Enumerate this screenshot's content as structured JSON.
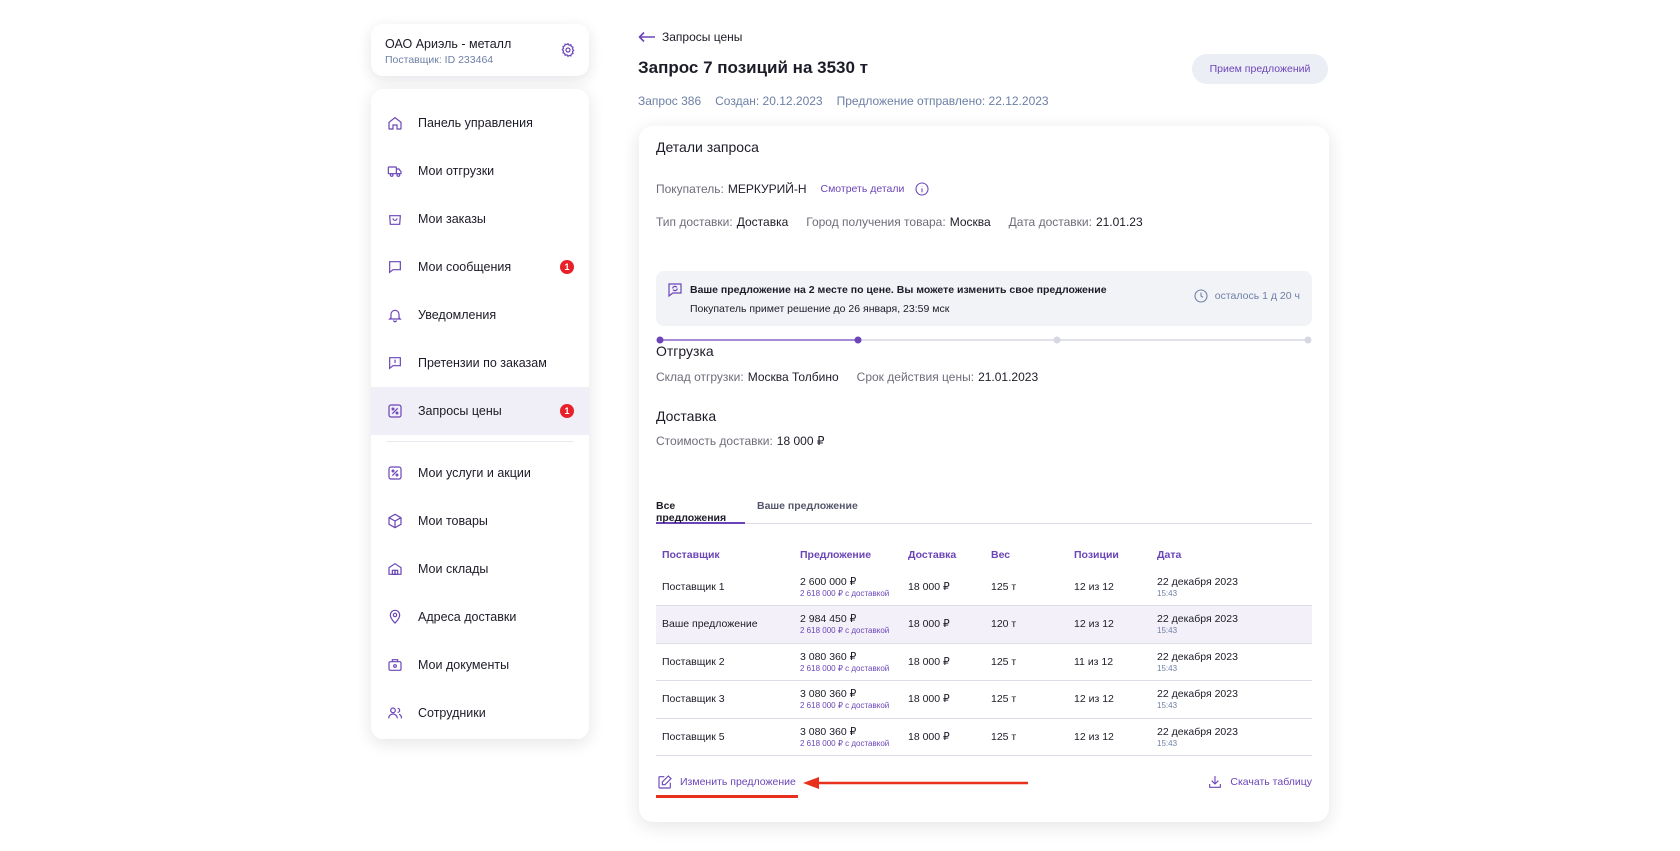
{
  "org": {
    "name": "ОАО Ариэль - металл",
    "supplier_id": "Поставщик: ID 233464"
  },
  "sidebar": {
    "items": [
      {
        "label": "Панель управления"
      },
      {
        "label": "Мои отгрузки"
      },
      {
        "label": "Мои заказы"
      },
      {
        "label": "Мои сообщения",
        "badge": "1"
      },
      {
        "label": "Уведомления"
      },
      {
        "label": "Претензии по заказам"
      },
      {
        "label": "Запросы цены",
        "badge": "1",
        "active": true
      },
      {
        "label": "Мои услуги и акции"
      },
      {
        "label": "Мои товары"
      },
      {
        "label": "Мои склады"
      },
      {
        "label": "Адреса доставки"
      },
      {
        "label": "Мои документы"
      },
      {
        "label": "Сотрудники"
      }
    ]
  },
  "header": {
    "back_label": "Запросы цены",
    "title": "Запрос 7 позиций на 3530 т",
    "status": "Прием предложений",
    "request_no": "Запрос 386",
    "created": "Создан: 20.12.2023",
    "offer_sent": "Предложение отправлено: 22.12.2023"
  },
  "details": {
    "section_title": "Детали запроса",
    "buyer_label": "Покупатель:",
    "buyer_value": "МЕРКУРИЙ-Н",
    "details_link": "Смотреть детали",
    "delivery_type_label": "Тип доставки:",
    "delivery_type_value": "Доставка",
    "city_label": "Город получения товара:",
    "city_value": "Москва",
    "delivery_date_label": "Дата доставки:",
    "delivery_date_value": "21.01.23"
  },
  "notice": {
    "title": "Ваше предложение на 2 месте по цене. Вы можете изменить свое предложение",
    "subtitle": "Покупатель примет решение до 26 января, 23:59 мск",
    "timer": "осталось 1 д 20 ч"
  },
  "progress": {
    "steps": 4,
    "completed": 2
  },
  "shipment": {
    "title": "Отгрузка",
    "warehouse_label": "Склад отгрузки:",
    "warehouse_value": "Москва Толбино",
    "price_valid_label": "Срок действия цены:",
    "price_valid_value": "21.01.2023"
  },
  "delivery": {
    "title": "Доставка",
    "cost_label": "Стоимость доставки:",
    "cost_value": "18 000 ₽"
  },
  "tabs": [
    {
      "label": "Все предложения",
      "active": true
    },
    {
      "label": "Ваше предложение",
      "active": false
    }
  ],
  "table": {
    "columns": [
      "Поставщик",
      "Предложение",
      "Доставка",
      "Вес",
      "Позиции",
      "Дата"
    ],
    "rows": [
      {
        "supplier": "Поставщик 1",
        "offer": "2 600 000 ₽",
        "offer_sub": "2 618 000 ₽ с доставкой",
        "delivery": "18 000 ₽",
        "weight": "125 т",
        "positions": "12 из 12",
        "date": "22 декабря 2023",
        "time": "15:43"
      },
      {
        "supplier": "Ваше предложение",
        "offer": "2 984 450 ₽",
        "offer_sub": "2 618 000 ₽ с доставкой",
        "delivery": "18 000 ₽",
        "weight": "120 т",
        "positions": "12 из 12",
        "date": "22 декабря 2023",
        "time": "15:43",
        "own": true
      },
      {
        "supplier": "Поставщик 2",
        "offer": "3 080 360 ₽",
        "offer_sub": "2 618 000 ₽ с доставкой",
        "delivery": "18 000 ₽",
        "weight": "125 т",
        "positions": "11 из 12",
        "date": "22 декабря 2023",
        "time": "15:43"
      },
      {
        "supplier": "Поставщик 3",
        "offer": "3 080 360 ₽",
        "offer_sub": "2 618 000 ₽ с доставкой",
        "delivery": "18 000 ₽",
        "weight": "125 т",
        "positions": "12 из 12",
        "date": "22 декабря 2023",
        "time": "15:43"
      },
      {
        "supplier": "Поставщик 5",
        "offer": "3 080 360 ₽",
        "offer_sub": "2 618 000 ₽ с доставкой",
        "delivery": "18 000 ₽",
        "weight": "125 т",
        "positions": "12 из 12",
        "date": "22 декабря 2023",
        "time": "15:43"
      }
    ]
  },
  "actions": {
    "edit_offer": "Изменить предложение",
    "download_table": "Скачать таблицу"
  },
  "colors": {
    "accent": "#6b45b8",
    "badge": "#e8202a",
    "annotation_arrow": "#e8311c"
  }
}
